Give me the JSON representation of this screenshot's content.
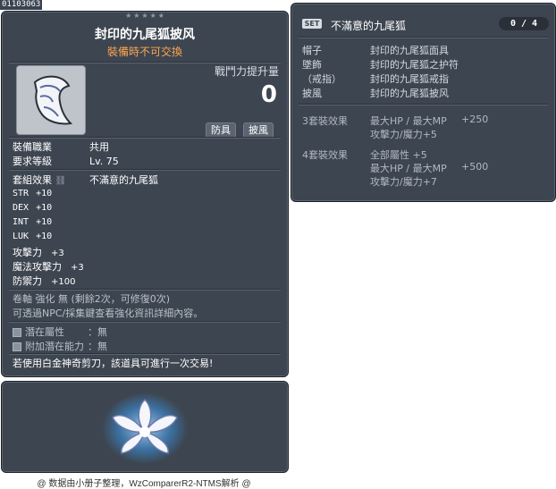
{
  "item_id": "01103063",
  "tooltip": {
    "stars": "★★★★★",
    "title": "封印的九尾狐披风",
    "trade_note": "裝備時不可交換",
    "combat_power_label": "戰鬥力提升量",
    "combat_power_value": "0",
    "tags": [
      "防具",
      "披風"
    ],
    "job_label": "裝備職業",
    "job_value": "共用",
    "level_label": "要求等級",
    "level_value": "Lv. 75",
    "set_label": "套組效果",
    "set_value": "不滿意的九尾狐",
    "stats": [
      {
        "name": "STR",
        "value": "+10"
      },
      {
        "name": "DEX",
        "value": "+10"
      },
      {
        "name": "INT",
        "value": "+10"
      },
      {
        "name": "LUK",
        "value": "+10"
      }
    ],
    "attack_stats": [
      {
        "name": "攻擊力",
        "value": "+3"
      },
      {
        "name": "魔法攻擊力",
        "value": "+3"
      },
      {
        "name": "防禦力",
        "value": "+100"
      }
    ],
    "upgrade_note": "卷軸 強化 無 (剩餘2次，可修復0次)",
    "upgrade_hint": "可透過NPC/採集鍵查看強化資訊詳細內容。",
    "potential_label": "潛在屬性",
    "potential_value": "：無",
    "bonus_potential_label": "附加潛在能力",
    "bonus_potential_value": "：無",
    "scissors_note": "若使用白金神奇剪刀，該道具可進行一次交易!"
  },
  "set_panel": {
    "badge": "SET",
    "name": "不滿意的九尾狐",
    "count": "0 / 4",
    "pieces": [
      {
        "slot": "帽子",
        "item": "封印的九尾狐面具"
      },
      {
        "slot": "墜飾",
        "item": "封印的九尾狐之护符"
      },
      {
        "slot": "（戒指）",
        "item": "封印的九尾狐戒指"
      },
      {
        "slot": "披風",
        "item": "封印的九尾狐披风"
      }
    ],
    "bonuses": [
      {
        "label": "3套裝效果",
        "lines": [
          {
            "text": "最大HP / 最大MP",
            "value": "+250"
          },
          {
            "text": "攻擊力/魔力+5",
            "value": ""
          }
        ]
      },
      {
        "label": "4套裝效果",
        "lines": [
          {
            "text": "全部屬性",
            "value": "+5"
          },
          {
            "text": "最大HP / 最大MP",
            "value": "+500"
          },
          {
            "text": "攻擊力/魔力+7",
            "value": ""
          }
        ]
      }
    ]
  },
  "footer": "@ 数据由小册子整理，WzComparerR2-NTMS解析 @",
  "colors": {
    "panel_bg": "#3d4550",
    "trade_note": "#ffa64d",
    "bonus_text": "#b1b8c1"
  }
}
